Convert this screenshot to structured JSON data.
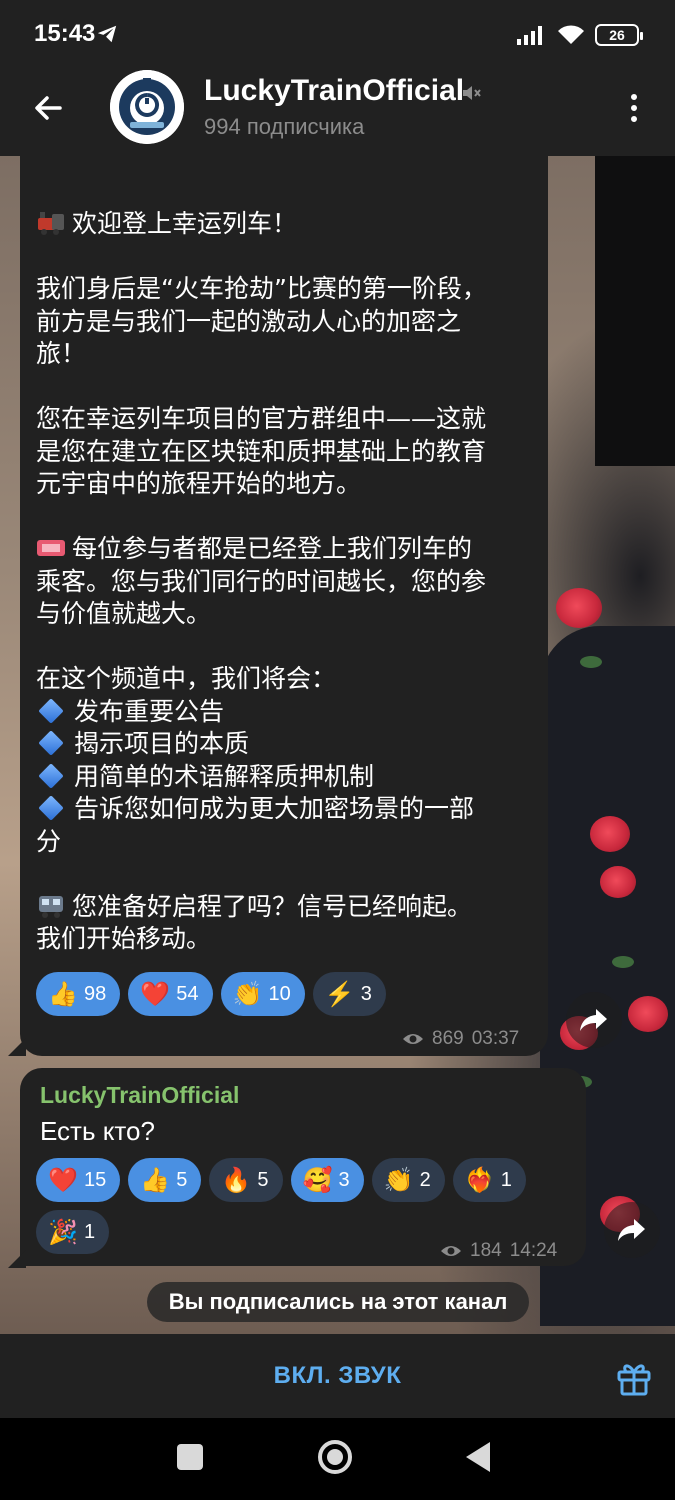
{
  "status_bar": {
    "time": "15:43",
    "battery": "26",
    "icons": [
      "telegram-send-icon",
      "signal-icon",
      "wifi-icon",
      "battery-icon"
    ]
  },
  "header": {
    "title": "LuckyTrainOfficial",
    "subtitle": "994 подписчика",
    "icons": [
      "back-arrow-icon",
      "channel-avatar",
      "muted-speaker-icon",
      "more-vert-icon"
    ]
  },
  "message1": {
    "lines": [
      "欢迎登上幸运列车！",
      "",
      "我们身后是“火车抢劫”比赛的第一阶段，",
      "前方是与我们一起的激动人心的加密之",
      "旅！",
      "",
      "您在幸运列车项目的官方群组中——这就",
      "是您在建立在区块链和质押基础上的教育",
      "元宇宙中的旅程开始的地方。",
      "",
      "每位参与者都是已经登上我们列车的",
      "乘客。您与我们同行的时间越长，您的参",
      "与价值就越大。",
      "",
      "在这个频道中，我们将会：",
      "发布重要公告",
      "揭示项目的本质",
      "用简单的术语解释质押机制",
      "告诉您如何成为更大加密场景的一部",
      "分",
      "",
      "您准备好启程了吗？信号已经响起。",
      "我们开始移动。"
    ],
    "reactions": [
      {
        "emoji": "👍",
        "count": "98",
        "active": true
      },
      {
        "emoji": "❤️",
        "count": "54",
        "active": true
      },
      {
        "emoji": "👏",
        "count": "10",
        "active": true
      },
      {
        "emoji": "⚡",
        "count": "3",
        "active": false
      }
    ],
    "views": "869",
    "time": "03:37"
  },
  "message2": {
    "sender": "LuckyTrainOfficial",
    "text": "Есть кто?",
    "reactions": [
      {
        "emoji": "❤️",
        "count": "15",
        "active": true
      },
      {
        "emoji": "👍",
        "count": "5",
        "active": true
      },
      {
        "emoji": "🔥",
        "count": "5",
        "active": false
      },
      {
        "emoji": "🥰",
        "count": "3",
        "active": true
      },
      {
        "emoji": "👏",
        "count": "2",
        "active": false
      },
      {
        "emoji": "❤️‍🔥",
        "count": "1",
        "active": false
      },
      {
        "emoji": "🎉",
        "count": "1",
        "active": false
      }
    ],
    "views": "184",
    "time": "14:24"
  },
  "service_message": "Вы подписались на этот канал",
  "bottom_bar": {
    "unmute_label": "ВКЛ. ЗВУК"
  },
  "colors": {
    "bar_bg": "#212121",
    "bubble_bg": "#212121",
    "accent": "#5eaef0",
    "sender": "#86c36d",
    "reaction_active": "#4a90e2",
    "reaction_inactive": "#2f3b4c"
  }
}
